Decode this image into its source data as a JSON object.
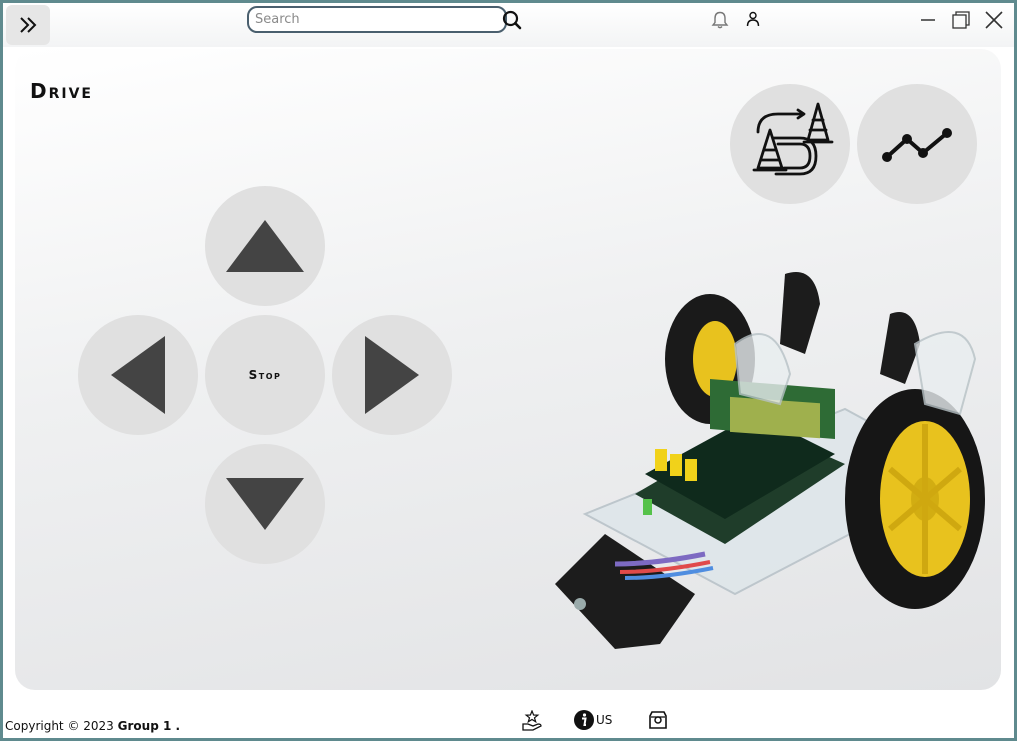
{
  "header": {
    "expand_label": "expand",
    "search": {
      "placeholder": "Search",
      "value": ""
    },
    "icons": [
      "chevrons-right-icon",
      "search-icon",
      "bell-icon",
      "user-icon",
      "minimize-icon",
      "maximize-icon",
      "close-icon"
    ]
  },
  "main": {
    "title": "Drive",
    "controls": {
      "up": "triangle-up-icon",
      "left": "triangle-left-icon",
      "stop_label": "Stop",
      "right": "triangle-right-icon",
      "down": "triangle-down-icon"
    },
    "modes": [
      "obstacle-course-icon",
      "line-graph-icon"
    ],
    "image": "robot-car-image"
  },
  "footer": {
    "copyright_prefix": "Copyright © 2023",
    "copyright_group": "Group 1 .",
    "about_label": "US",
    "icons": [
      "award-hand-icon",
      "info-icon",
      "contact-icon"
    ]
  },
  "colors": {
    "control_fill": "#e0e0e0",
    "arrow_fill": "#444444",
    "border": "#4a5f6e"
  }
}
